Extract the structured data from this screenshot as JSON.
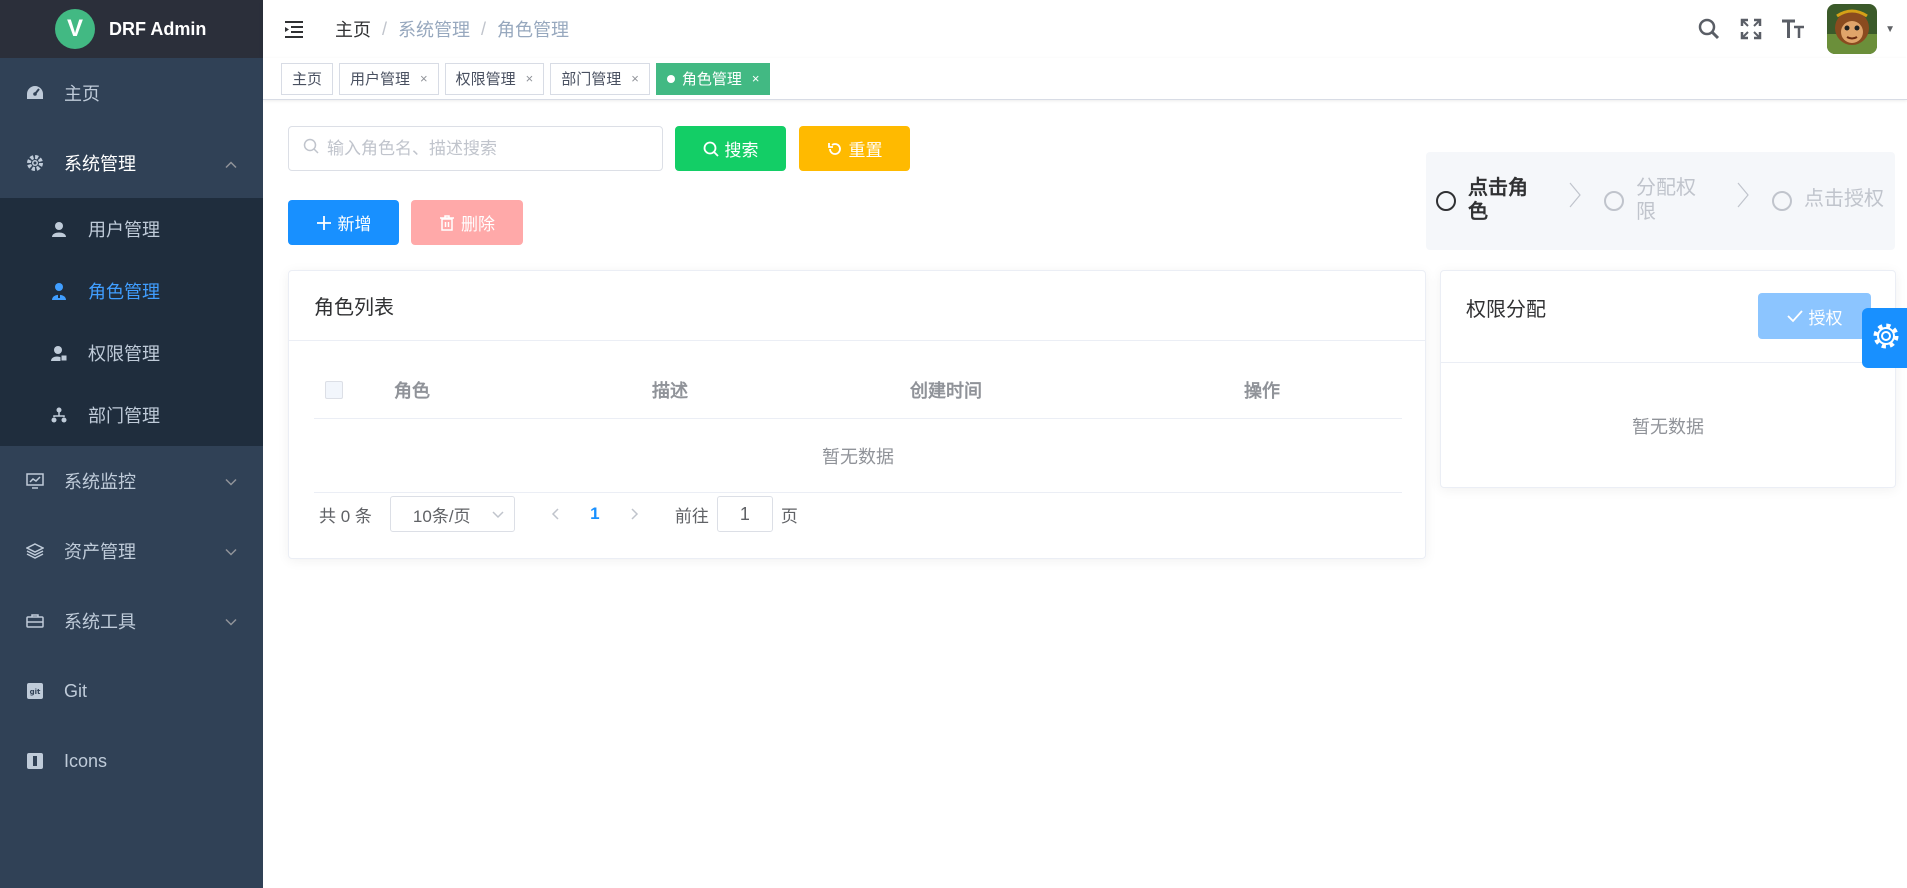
{
  "app": {
    "logo_letter": "V",
    "title": "DRF Admin"
  },
  "sidebar": {
    "items": [
      {
        "label": "主页"
      },
      {
        "label": "系统管理",
        "expanded": true,
        "children": [
          {
            "label": "用户管理"
          },
          {
            "label": "角色管理",
            "active": true
          },
          {
            "label": "权限管理"
          },
          {
            "label": "部门管理"
          }
        ]
      },
      {
        "label": "系统监控"
      },
      {
        "label": "资产管理"
      },
      {
        "label": "系统工具"
      },
      {
        "label": "Git"
      },
      {
        "label": "Icons"
      }
    ]
  },
  "breadcrumb": [
    "主页",
    "系统管理",
    "角色管理"
  ],
  "tags": [
    {
      "label": "主页",
      "closable": false
    },
    {
      "label": "用户管理",
      "closable": true
    },
    {
      "label": "权限管理",
      "closable": true
    },
    {
      "label": "部门管理",
      "closable": true
    },
    {
      "label": "角色管理",
      "closable": true,
      "active": true
    }
  ],
  "toolbar": {
    "search_placeholder": "输入角色名、描述搜索",
    "search_label": "搜索",
    "reset_label": "重置",
    "add_label": "新增",
    "delete_label": "删除"
  },
  "roles_card": {
    "title": "角色列表",
    "columns": [
      "角色",
      "描述",
      "创建时间",
      "操作"
    ],
    "empty_text": "暂无数据"
  },
  "pagination": {
    "total_text": "共 0 条",
    "page_size": "10条/页",
    "current_page": "1",
    "goto_prefix": "前往",
    "goto_value": "1",
    "goto_suffix": "页"
  },
  "steps": [
    {
      "title": "点击角色",
      "state": "active"
    },
    {
      "title": "分配权限",
      "state": "wait"
    },
    {
      "title": "点击授权",
      "state": "wait"
    }
  ],
  "perm_card": {
    "title": "权限分配",
    "grant_label": "授权",
    "empty_text": "暂无数据"
  },
  "colors": {
    "sidebar_bg": "#304156",
    "submenu_bg": "#1f2d3d",
    "active_text": "#409eff",
    "tag_active": "#42b983",
    "search_btn": "#13ce66",
    "reset_btn": "#ffba00",
    "primary": "#1890ff",
    "delete_disabled": "#ffa9a9",
    "grant_disabled": "#8cc5ff"
  }
}
